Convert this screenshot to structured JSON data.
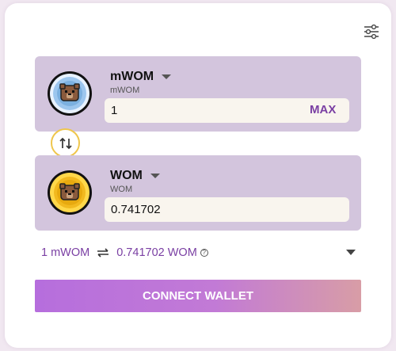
{
  "from_token": {
    "symbol": "mWOM",
    "subtitle": "mWOM",
    "amount": "1",
    "max_label": "MAX",
    "icon": "wombat-blue-coin-icon"
  },
  "to_token": {
    "symbol": "WOM",
    "subtitle": "WOM",
    "amount": "0.741702",
    "icon": "wombat-gold-coin-icon"
  },
  "rate": {
    "left": "1 mWOM",
    "right": "0.741702 WOM",
    "help_glyph": "?"
  },
  "connect_label": "CONNECT WALLET",
  "colors": {
    "panel": "#d3c5dd",
    "accent_purple": "#7a3fa3",
    "swap_border": "#efc64c",
    "button_gradient_start": "#b66edd",
    "button_gradient_end": "#d89da6"
  }
}
